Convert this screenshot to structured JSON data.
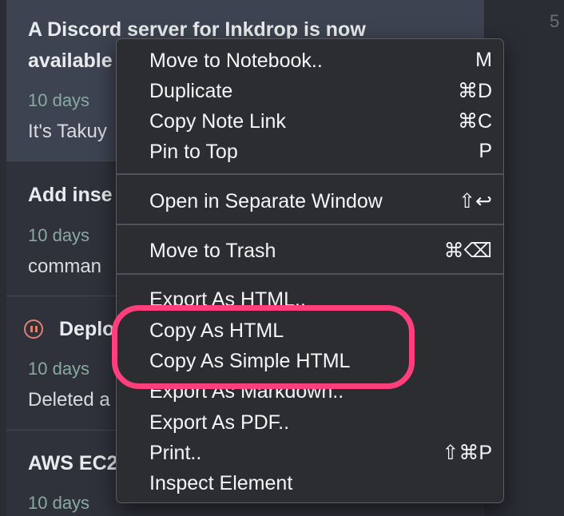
{
  "right_pane": {
    "page_number": "5"
  },
  "notes": [
    {
      "title": "A Discord server for Inkdrop is now",
      "title_line2": "available",
      "date": "10 days",
      "preview": "It's Takuy"
    },
    {
      "title": "Add inse",
      "date": "10 days",
      "preview": "comman"
    },
    {
      "title": "Deplo",
      "date": "10 days",
      "preview": "Deleted a"
    },
    {
      "title": "AWS EC2",
      "date": "10 days"
    }
  ],
  "context_menu": {
    "groups": [
      [
        {
          "label": "Move to Notebook..",
          "shortcut": "M"
        },
        {
          "label": "Duplicate",
          "shortcut": "⌘D"
        },
        {
          "label": "Copy Note Link",
          "shortcut": "⌘C"
        },
        {
          "label": "Pin to Top",
          "shortcut": "P"
        }
      ],
      [
        {
          "label": "Open in Separate Window",
          "shortcut": "⇧↩"
        }
      ],
      [
        {
          "label": "Move to Trash",
          "shortcut": "⌘⌫"
        }
      ],
      [
        {
          "label": "Export As HTML..",
          "shortcut": ""
        },
        {
          "label": "Copy As HTML",
          "shortcut": ""
        },
        {
          "label": "Copy As Simple HTML",
          "shortcut": ""
        },
        {
          "label": "Export As Markdown..",
          "shortcut": ""
        },
        {
          "label": "Export As PDF..",
          "shortcut": ""
        },
        {
          "label": "Print..",
          "shortcut": "⇧⌘P"
        },
        {
          "label": "Inspect Element",
          "shortcut": ""
        }
      ]
    ]
  },
  "highlight_color": "#ff3f7c"
}
